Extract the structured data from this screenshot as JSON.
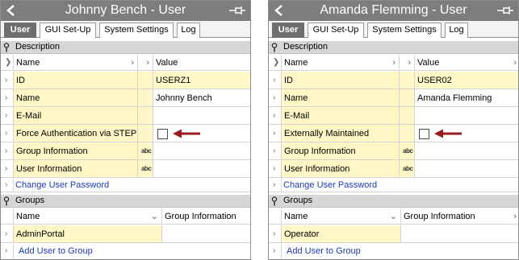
{
  "tabs_labels": [
    "User",
    "GUI Set-Up",
    "System Settings",
    "Log"
  ],
  "panels": [
    {
      "title": "Johnny Bench - User",
      "tabs": [
        "User",
        "GUI Set-Up",
        "System Settings",
        "Log"
      ],
      "description_header": "Description",
      "col_name": "Name",
      "col_value": "Value",
      "rows": [
        {
          "name": "ID",
          "value": "USERZ1"
        },
        {
          "name": "Name",
          "value": "Johnny Bench"
        },
        {
          "name": "E-Mail",
          "value": ""
        },
        {
          "name": "Force Authentication via STEP",
          "value": ""
        },
        {
          "name": "Group Information",
          "value": ""
        },
        {
          "name": "User Information",
          "value": ""
        }
      ],
      "change_password_link": "Change User Password",
      "groups_header": "Groups",
      "groups_col_name": "Name",
      "groups_col_info": "Group Information",
      "group_rows": [
        {
          "name": "AdminPortal",
          "info": ""
        }
      ],
      "add_to_group_link": "Add User to Group"
    },
    {
      "title": "Amanda Flemming - User",
      "tabs": [
        "User",
        "GUI Set-Up",
        "System Settings",
        "Log"
      ],
      "description_header": "Description",
      "col_name": "Name",
      "col_value": "Value",
      "rows": [
        {
          "name": "ID",
          "value": "USER02"
        },
        {
          "name": "Name",
          "value": "Amanda Flemming"
        },
        {
          "name": "E-Mail",
          "value": ""
        },
        {
          "name": "Externally Maintained",
          "value": ""
        },
        {
          "name": "Group Information",
          "value": ""
        },
        {
          "name": "User Information",
          "value": ""
        }
      ],
      "change_password_link": "Change User Password",
      "groups_header": "Groups",
      "groups_col_name": "Name",
      "groups_col_info": "Group Information",
      "group_rows": [
        {
          "name": "Operator",
          "info": ""
        }
      ],
      "add_to_group_link": "Add User to Group"
    }
  ],
  "icons": {
    "back": "back-arrow-icon",
    "pin": "pin-icon",
    "key": "key-icon",
    "chevron": "chevron-right-icon",
    "abc": "abc-text-icon",
    "checkbox": "checkbox-icon",
    "annotation": "red-arrow-icon"
  },
  "abc_label": "abc",
  "colors": {
    "titlebar": "#7d7d7d",
    "active_tab": "#6e6e6e",
    "section_header": "#d6d6d6",
    "highlight": "#fff8c6",
    "link": "#1a3bb3",
    "annotation_arrow": "#9b1c1c"
  }
}
